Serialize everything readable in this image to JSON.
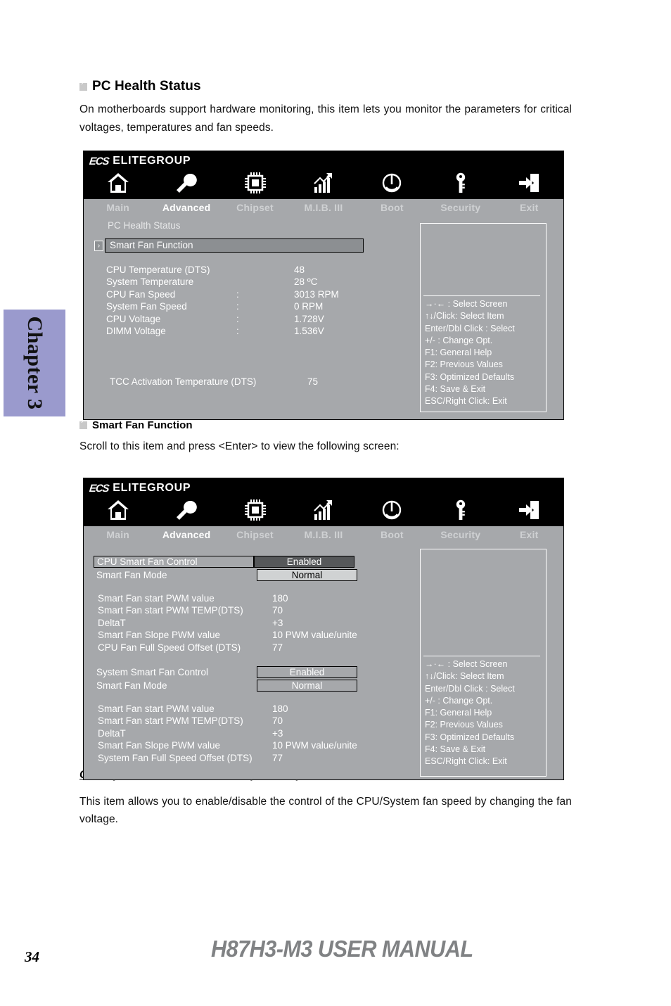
{
  "page": {
    "chapter_tab": "Chapter 3",
    "page_number": "34",
    "manual_title": "H87H3-M3 USER MANUAL"
  },
  "sections": {
    "pc_health": {
      "heading": "PC Health Status",
      "body": "On motherboards support hardware monitoring, this item lets you monitor the parameters for critical voltages, temperatures and fan speeds."
    },
    "smart_fan": {
      "heading": "Smart Fan Function",
      "body": "Scroll to this item and press <Enter> to view the following screen:"
    },
    "control_desc": {
      "heading": "CPU/System Smart Fan Control (Enabled)",
      "body": "This item allows you to enable/disable the control of the CPU/System fan speed by changing the fan voltage."
    }
  },
  "bios": {
    "brand_badge": "ECS",
    "brand_name": "ELITEGROUP",
    "tabs": [
      {
        "label": "Main",
        "icon": "home-icon",
        "active": false
      },
      {
        "label": "Advanced",
        "icon": "wrench-icon",
        "active": true
      },
      {
        "label": "Chipset",
        "icon": "chip-icon",
        "active": false
      },
      {
        "label": "M.I.B. III",
        "icon": "chart-icon",
        "active": false
      },
      {
        "label": "Boot",
        "icon": "power-icon",
        "active": false
      },
      {
        "label": "Security",
        "icon": "key-icon",
        "active": false
      },
      {
        "label": "Exit",
        "icon": "exit-door-icon",
        "active": false
      }
    ],
    "help": [
      "→·←   : Select Screen",
      "↑↓/Click: Select Item",
      "Enter/Dbl Click : Select",
      "+/- : Change Opt.",
      "F1: General Help",
      "F2: Previous Values",
      "F3: Optimized Defaults",
      "F4: Save & Exit",
      "ESC/Right Click: Exit"
    ]
  },
  "screen1": {
    "page_label": "PC Health Status",
    "highlighted_row": "Smart Fan Function",
    "readings": [
      {
        "name": "CPU Temperature (DTS)",
        "sep": "",
        "value": "48"
      },
      {
        "name": "System Temperature",
        "sep": "",
        "value": "28 ºC"
      },
      {
        "name": "CPU Fan Speed",
        "sep": ":",
        "value": "3013 RPM"
      },
      {
        "name": "System Fan Speed",
        "sep": ":",
        "value": "0 RPM"
      },
      {
        "name": "CPU Voltage",
        "sep": ":",
        "value": "1.728V"
      },
      {
        "name": "DIMM Voltage",
        "sep": ":",
        "value": "1.536V"
      }
    ],
    "tcc": {
      "name": "TCC Activation Temperature (DTS)",
      "value": "75"
    }
  },
  "screen2": {
    "cpu_group": {
      "control_label": "CPU Smart Fan Control",
      "control_value": "Enabled",
      "mode_label": "Smart Fan Mode",
      "mode_value": "Normal",
      "params": [
        {
          "name": "Smart  Fan start PWM value",
          "value": "180"
        },
        {
          "name": "Smart  Fan start PWM TEMP(DTS)",
          "value": "70"
        },
        {
          "name": "DeltaT",
          "value": "+3"
        },
        {
          "name": "Smart  Fan Slope PWM value",
          "value": "10 PWM value/unite"
        },
        {
          "name": "CPU Fan Full Speed Offset (DTS)",
          "value": "77"
        }
      ]
    },
    "system_group": {
      "control_label": "System Smart Fan Control",
      "control_value": "Enabled",
      "mode_label": "Smart Fan Mode",
      "mode_value": "Normal",
      "params": [
        {
          "name": "Smart  Fan start PWM value",
          "value": "180"
        },
        {
          "name": "Smart  Fan start PWM TEMP(DTS)",
          "value": "70"
        },
        {
          "name": "DeltaT",
          "value": "+3"
        },
        {
          "name": "Smart  Fan Slope PWM value",
          "value": "10 PWM value/unite"
        },
        {
          "name": "System Fan Full Speed Offset (DTS)",
          "value": "77"
        }
      ]
    }
  }
}
